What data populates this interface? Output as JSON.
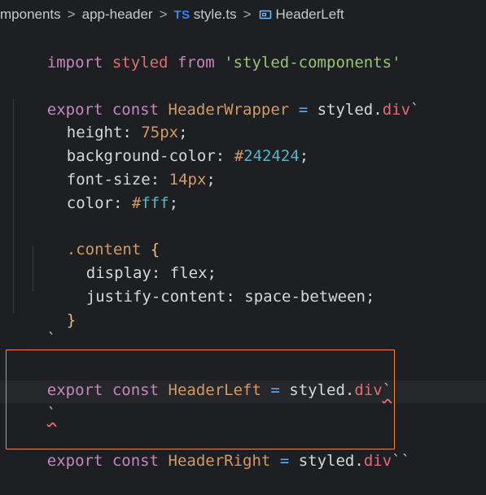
{
  "breadcrumb": {
    "segment1": "mponents",
    "segment2": "app-header",
    "ts_badge": "TS",
    "segment3": "style.ts",
    "segment4": "HeaderLeft",
    "separator": ">"
  },
  "code": {
    "l1": {
      "kw": "import",
      "name": "styled",
      "from": "from",
      "module": "'styled-components'"
    },
    "l3": {
      "kw": "export",
      "kw2": "const",
      "name": "HeaderWrapper",
      "eq": "=",
      "obj": "styled",
      "dot": ".",
      "tag": "div",
      "tick": "`"
    },
    "l4": {
      "prop": "height",
      "colon": ":",
      "val": "75px",
      "semi": ";"
    },
    "l5": {
      "prop": "background-color",
      "colon": ":",
      "hash": "#",
      "val": "242424",
      "semi": ";"
    },
    "l6": {
      "prop": "font-size",
      "colon": ":",
      "val": "14px",
      "semi": ";"
    },
    "l7": {
      "prop": "color",
      "colon": ":",
      "hash": "#",
      "val": "fff",
      "semi": ";"
    },
    "l9": {
      "selector": ".content",
      "brace": "{"
    },
    "l10": {
      "prop": "display",
      "colon": ":",
      "val": "flex",
      "semi": ";"
    },
    "l11": {
      "prop": "justify-content",
      "colon": ":",
      "val": "space-between",
      "semi": ";"
    },
    "l12": {
      "brace": "}"
    },
    "l13": {
      "tick": "`"
    },
    "l15": {
      "kw": "export",
      "kw2": "const",
      "name": "HeaderLeft",
      "eq": "=",
      "obj": "styled",
      "dot": ".",
      "tag": "div",
      "tick": "`"
    },
    "l16": {
      "tick": "`"
    },
    "l17": {
      "kw": "export",
      "kw2": "const",
      "name": "HeaderRight",
      "eq": "=",
      "obj": "styled",
      "dot": ".",
      "tag": "div",
      "tick": "``"
    }
  },
  "colors": {
    "highlight_border": "#f08a3a",
    "background": "#1e1f22"
  }
}
